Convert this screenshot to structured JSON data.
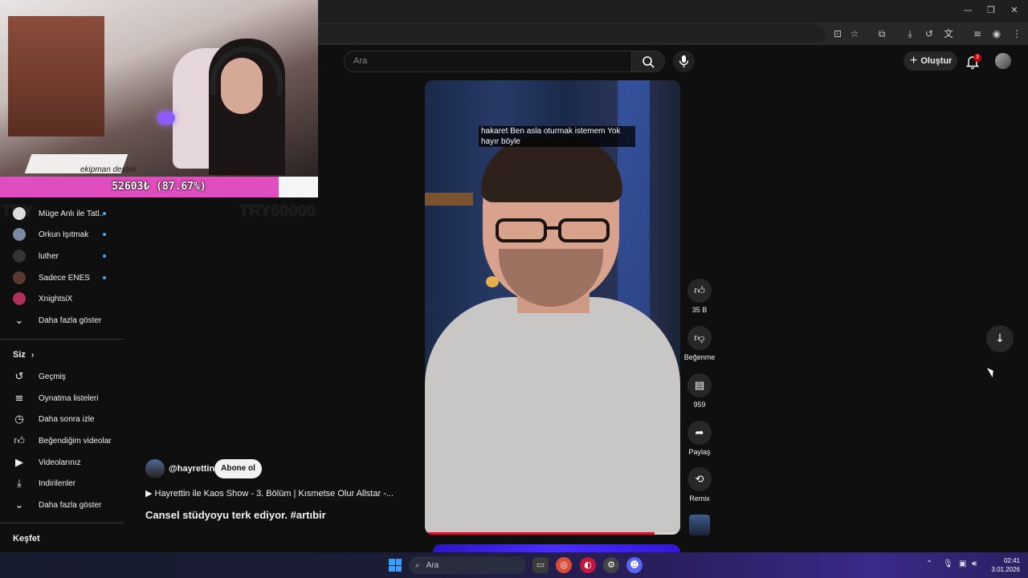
{
  "header": {
    "search_placeholder": "Ara",
    "create_label": "Oluştur",
    "notification_count": "3"
  },
  "overlay": {
    "goal_text": "52603₺ (87.67%)",
    "goal_progress_fraction": 0.8767,
    "goal_left": "TRY",
    "goal_right": "TRY60000",
    "cam_text": "ekipman destek"
  },
  "sidebar": {
    "subscriptions": [
      {
        "label": "Müge Anlı ile Tatl...",
        "live": true
      },
      {
        "label": "Orkun Işıtmak",
        "live": true
      },
      {
        "label": "luther",
        "live": true
      },
      {
        "label": "Sadece ENES",
        "live": true
      },
      {
        "label": "XnightsiX",
        "live": false
      }
    ],
    "show_more": "Daha fazla göster",
    "you_header": "Siz",
    "you_items": [
      {
        "label": "Geçmiş",
        "icon": "history-icon"
      },
      {
        "label": "Oynatma listeleri",
        "icon": "playlists-icon"
      },
      {
        "label": "Daha sonra izle",
        "icon": "watch-later-icon"
      },
      {
        "label": "Beğendiğim videolar",
        "icon": "like-icon"
      },
      {
        "label": "Videolarınız",
        "icon": "your-videos-icon"
      },
      {
        "label": "İndirilenler",
        "icon": "download-icon"
      }
    ],
    "you_show_more": "Daha fazla göster",
    "explore_header": "Keşfet"
  },
  "short": {
    "caption_line1": "hakaret Ben asla oturmak istemem Yok",
    "caption_line2": "hayır böyle",
    "progress_fraction": 0.9,
    "channel": "@hayrettin",
    "subscribe": "Abone ol",
    "linked_video": "▶ Hayrettin ile Kaos Show - 3. Bölüm | Kısmetse Olur Allstar -...",
    "title": "Cansel stüdyoyu terk ediyor. #artıbir"
  },
  "actions": {
    "likes": "35 B",
    "dislike": "Beğenme",
    "comments": "959",
    "share": "Paylaş",
    "remix": "Remix"
  },
  "taskbar": {
    "search": "Ara",
    "time": "02:41",
    "date": "3.01.2026"
  },
  "colors": {
    "accent_red": "#ff0033",
    "goal_pink": "#e04dbe",
    "live_dot": "#3ea6ff"
  }
}
